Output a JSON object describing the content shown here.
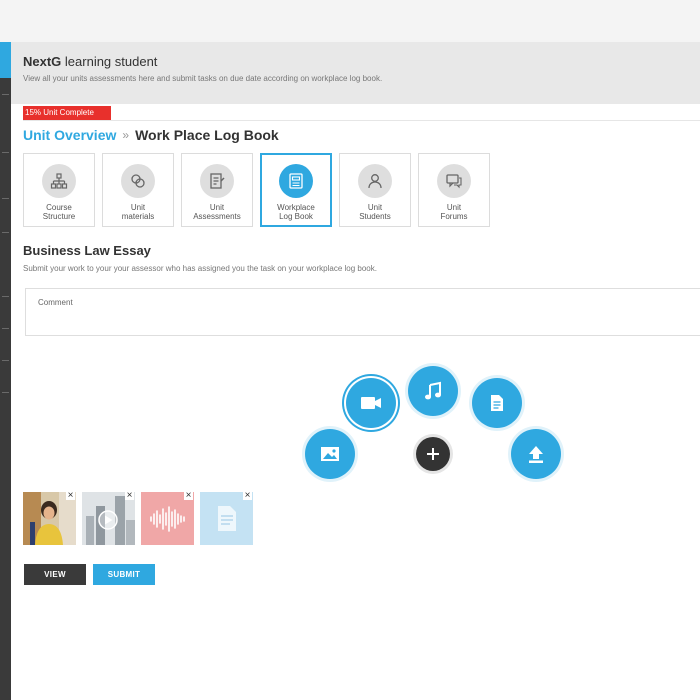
{
  "header": {
    "app_name": "NextG",
    "title_rest": " learning student",
    "subtitle": "View all your units assessments here and submit tasks on due date according on workplace log book."
  },
  "progress": {
    "label": "15% Unit Complete",
    "percent": 15
  },
  "breadcrumb": {
    "parent": "Unit Overview",
    "separator": "»",
    "current": "Work Place Log Book"
  },
  "tiles": [
    {
      "line1": "Course",
      "line2": "Structure",
      "icon": "org-chart-icon"
    },
    {
      "line1": "Unit",
      "line2": "materials",
      "icon": "materials-icon"
    },
    {
      "line1": "Unit",
      "line2": "Assessments",
      "icon": "assessment-icon"
    },
    {
      "line1": "Workplace",
      "line2": "Log Book",
      "icon": "logbook-icon",
      "active": true
    },
    {
      "line1": "Unit",
      "line2": "Students",
      "icon": "student-icon"
    },
    {
      "line1": "Unit",
      "line2": "Forums",
      "icon": "forum-icon"
    }
  ],
  "task": {
    "title": "Business Law Essay",
    "instructions": "Submit your work to your  your assessor who has assigned you the task on your workplace log book.",
    "comment_placeholder": "Comment"
  },
  "actions": {
    "view_label": "VIEW",
    "submit_label": "SUBMIT"
  },
  "colors": {
    "accent": "#2fa8e0",
    "progress": "#e8302c",
    "dark": "#3a3a3a"
  }
}
